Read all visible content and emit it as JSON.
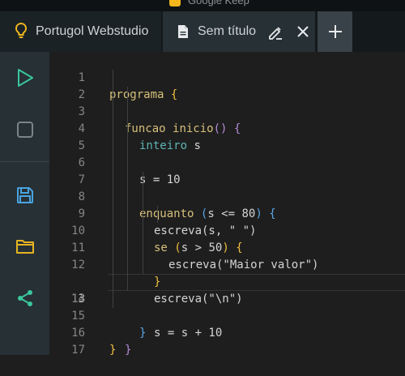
{
  "window": {
    "title": "Google Keep"
  },
  "tabs": {
    "home_label": "Portugol Webstudio",
    "file_label": "Sem título"
  },
  "sidebar": {
    "buttons": [
      "play-icon",
      "stop-icon",
      "save-icon",
      "folder-icon",
      "share-icon"
    ]
  },
  "editor": {
    "active_line": 13,
    "line_numbers": [
      "1",
      "2",
      "3",
      "4",
      "5",
      "6",
      "7",
      "8",
      "9",
      "10",
      "11",
      "12",
      "13",
      "14",
      "15",
      "16",
      "17"
    ],
    "code": {
      "l1_kw": "programa",
      "l1_br": "{",
      "l2_kw": "funcao",
      "l2_name": "inicio",
      "l2_paren": "()",
      "l2_br": "{",
      "l3_type": "inteiro",
      "l3_rest": "s",
      "l5": "s = 10",
      "l7_kw": "enquanto",
      "l7_paren_open": "(",
      "l7_cond": "s <= 80",
      "l7_paren_close": ")",
      "l7_br": "{",
      "l8": "escreva(s, \" \")",
      "l9_kw": "se",
      "l9_paren_open": "(",
      "l9_cond": "s > 50",
      "l9_paren_close": ")",
      "l9_br": "{",
      "l10": "escreva(\"Maior valor\")",
      "l11": "}",
      "l12": "escreva(\"\\n\")",
      "l13": "s = s + 10",
      "l14": "}",
      "l15": "}",
      "l16": "}"
    }
  },
  "colors": {
    "keyword": "#d6c07a",
    "type": "#5fb3b3",
    "icon_green": "#3ac79b",
    "icon_blue": "#4aa3e0",
    "icon_yellow": "#e6b422"
  }
}
